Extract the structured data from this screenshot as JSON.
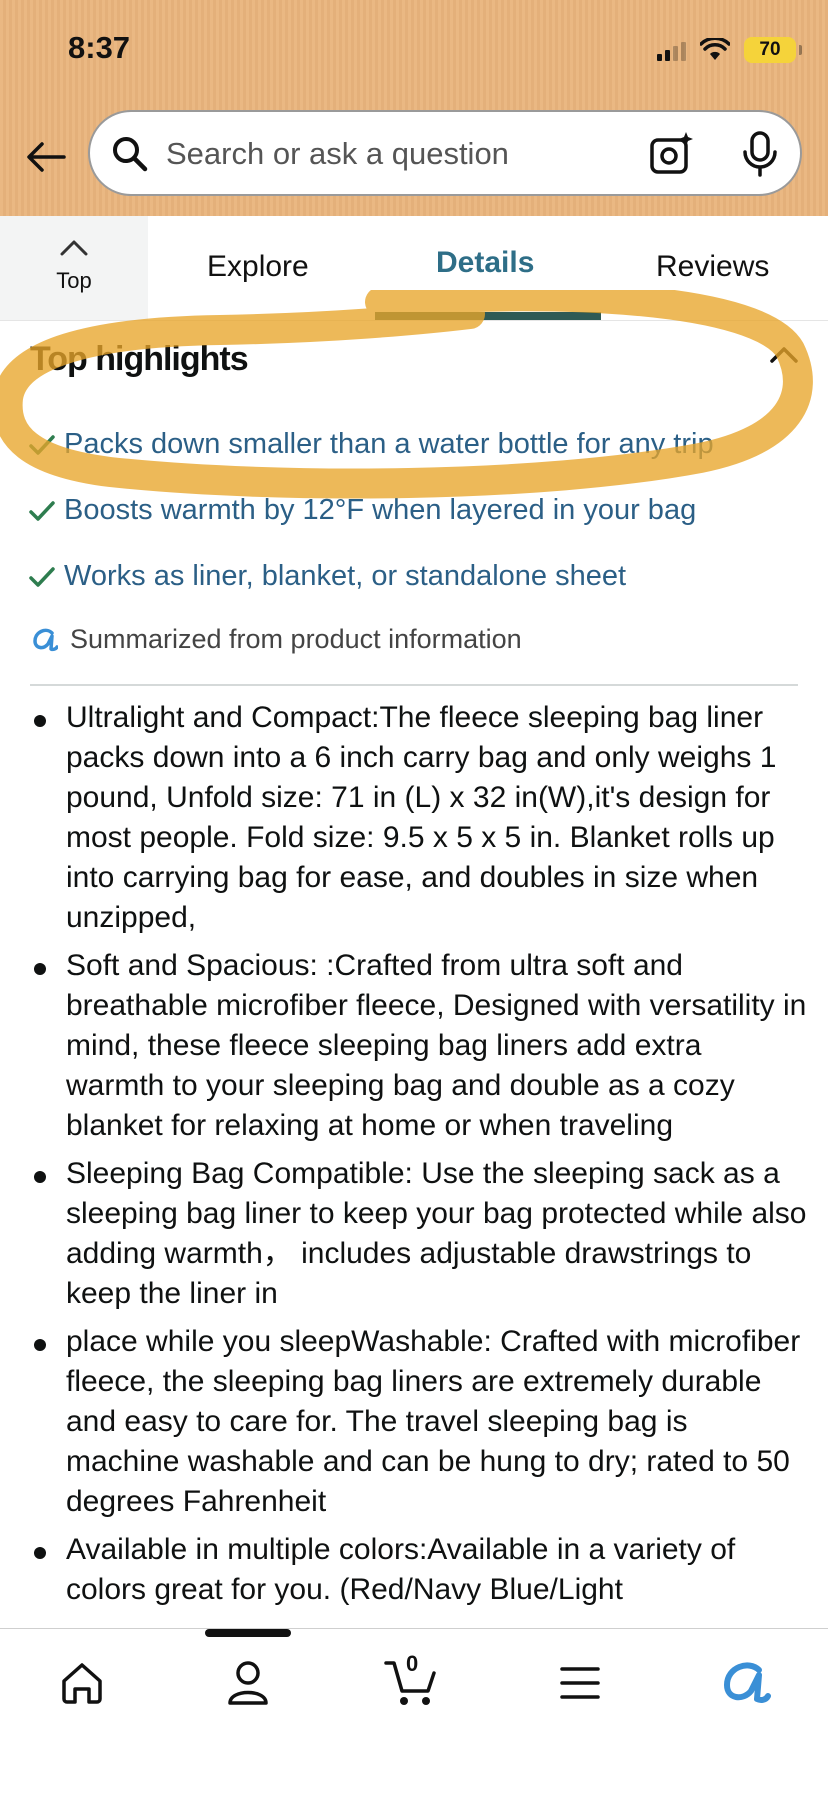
{
  "status_bar": {
    "time": "8:37",
    "battery": "70"
  },
  "search": {
    "placeholder": "Search or ask a question"
  },
  "tabs": {
    "top_label": "Top",
    "items": [
      {
        "label": "Explore",
        "active": false
      },
      {
        "label": "Details",
        "active": true
      },
      {
        "label": "Reviews",
        "active": false
      }
    ]
  },
  "highlights": {
    "title": "Top highlights",
    "items": [
      "Packs down smaller than a water bottle for any trip",
      "Boosts warmth by 12°F when layered in your bag",
      "Works as liner, blanket, or standalone sheet"
    ],
    "summary": "Summarized from product information"
  },
  "bullets": [
    "Ultralight and Compact:The fleece sleeping bag liner packs down into a 6 inch carry bag and only weighs 1 pound, Unfold size: 71 in (L) x 32 in(W),it's design for most people. Fold size: 9.5 x 5 x 5 in. Blanket rolls up into carrying bag for ease, and doubles in size when unzipped,",
    "Soft and Spacious: :Crafted from ultra soft and breathable microfiber fleece, Designed with versatility in mind, these fleece sleeping bag liners add extra warmth to your sleeping bag and double as a cozy blanket for relaxing at home or when traveling",
    "Sleeping Bag Compatible: Use the sleeping sack as a sleeping bag liner to keep your bag protected while also adding warmth，  includes adjustable drawstrings to keep the liner in",
    "place while you sleepWashable: Crafted with microfiber fleece, the sleeping bag liners are extremely durable and easy to care for. The travel sleeping bag is machine washable and can be hung to dry; rated to 50 degrees Fahrenheit",
    "Available in multiple colors:Available in a variety of colors great for you. (Red/Navy Blue/Light"
  ],
  "bottom_nav": {
    "cart_count": "0"
  },
  "colors": {
    "header": "#e9b47c",
    "link": "#2b5f86",
    "check": "#2e7d4f",
    "active_tab": "#2e6e87",
    "marker": "#e8a52a"
  }
}
